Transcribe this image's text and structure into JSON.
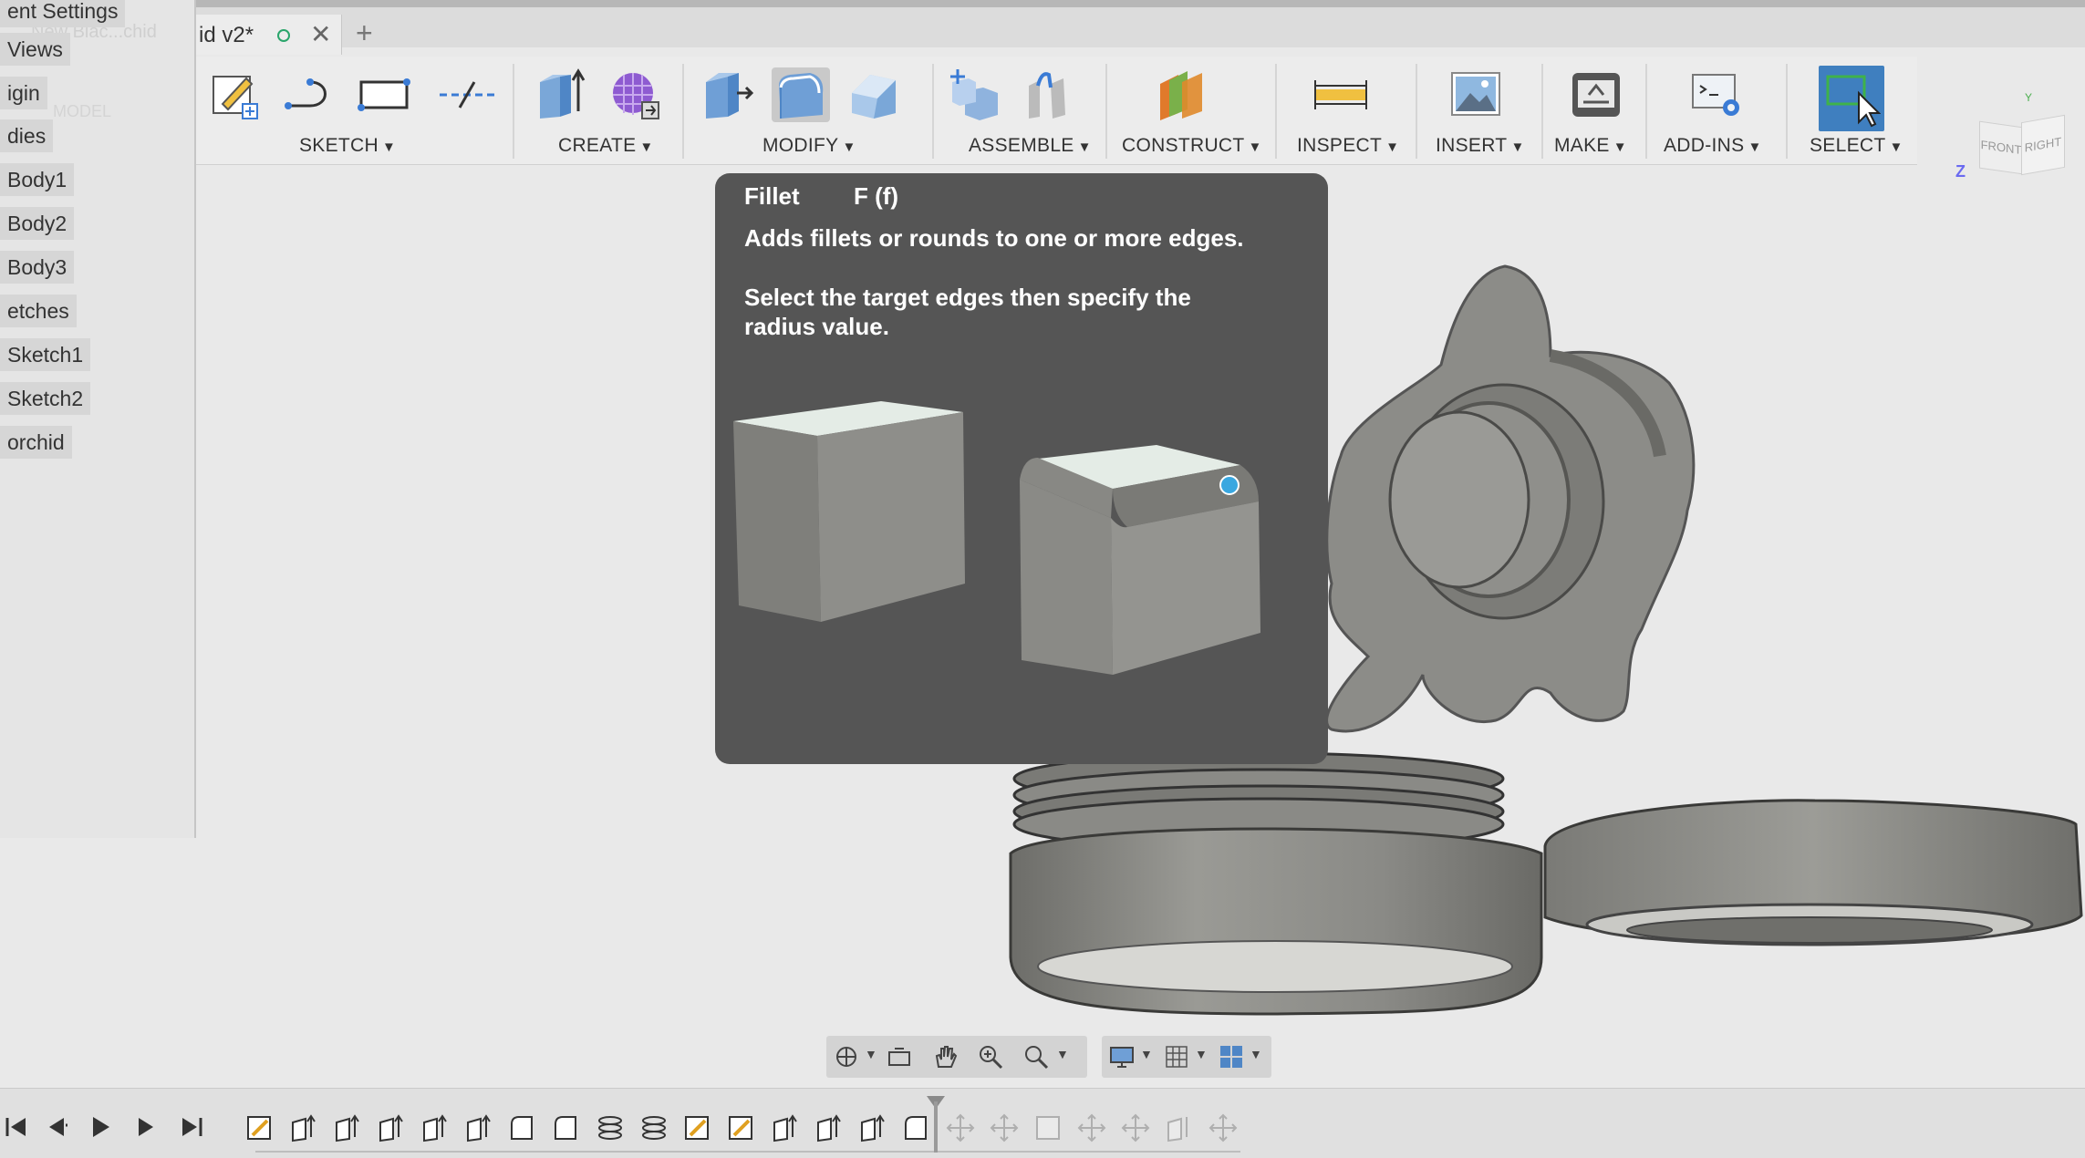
{
  "tab": {
    "title": "id v2*",
    "close": "✕",
    "add": "+"
  },
  "browser": {
    "ghost_text": "New Blac...chid",
    "ghost_text2": "MODEL",
    "items": [
      {
        "label": "ent Settings"
      },
      {
        "label": "Views"
      },
      {
        "label": "igin"
      },
      {
        "label": "dies"
      },
      {
        "label": "Body1"
      },
      {
        "label": "Body2"
      },
      {
        "label": "Body3"
      },
      {
        "label": "etches"
      },
      {
        "label": "Sketch1"
      },
      {
        "label": "Sketch2"
      },
      {
        "label": "orchid"
      }
    ]
  },
  "toolbar": {
    "groups": [
      {
        "label": "SKETCH",
        "caret": "▼"
      },
      {
        "label": "CREATE",
        "caret": "▼"
      },
      {
        "label": "MODIFY",
        "caret": "▼"
      },
      {
        "label": "ASSEMBLE",
        "caret": "▼"
      },
      {
        "label": "CONSTRUCT",
        "caret": "▼"
      },
      {
        "label": "INSPECT",
        "caret": "▼"
      },
      {
        "label": "INSERT",
        "caret": "▼"
      },
      {
        "label": "MAKE",
        "caret": "▼"
      },
      {
        "label": "ADD-INS",
        "caret": "▼"
      },
      {
        "label": "SELECT",
        "caret": "▼"
      }
    ]
  },
  "viewcube": {
    "front": "FRONT",
    "right": "RIGHT",
    "z": "Z",
    "y": "Y"
  },
  "tooltip": {
    "title": "Fillet",
    "shortcut": "F (f)",
    "description": "Adds fillets or rounds to one or more edges.",
    "instructions": "Select the target edges then specify the radius value."
  },
  "colors": {
    "accent_select": "#3f7fbf",
    "tooltip_bg": "#555555",
    "model_gray": "#8a8a86",
    "panel_bg": "#e5e5e5"
  },
  "icons": {
    "toolbar": [
      "create-sketch-icon",
      "spline-icon",
      "rectangle-icon",
      "line-icon",
      "extrude-icon",
      "form-icon",
      "press-pull-icon",
      "fillet-icon",
      "chamfer-icon",
      "new-component-icon",
      "joint-icon",
      "offset-plane-icon",
      "measure-icon",
      "insert-canvas-icon",
      "3d-print-icon",
      "scripts-icon",
      "select-icon"
    ],
    "nav": [
      "orbit-icon",
      "look-at-icon",
      "pan-icon",
      "zoom-window-icon",
      "zoom-icon",
      "display-settings-icon",
      "grid-icon",
      "viewports-icon"
    ],
    "playback": [
      "first-icon",
      "previous-icon",
      "play-icon",
      "next-icon",
      "last-icon"
    ]
  }
}
